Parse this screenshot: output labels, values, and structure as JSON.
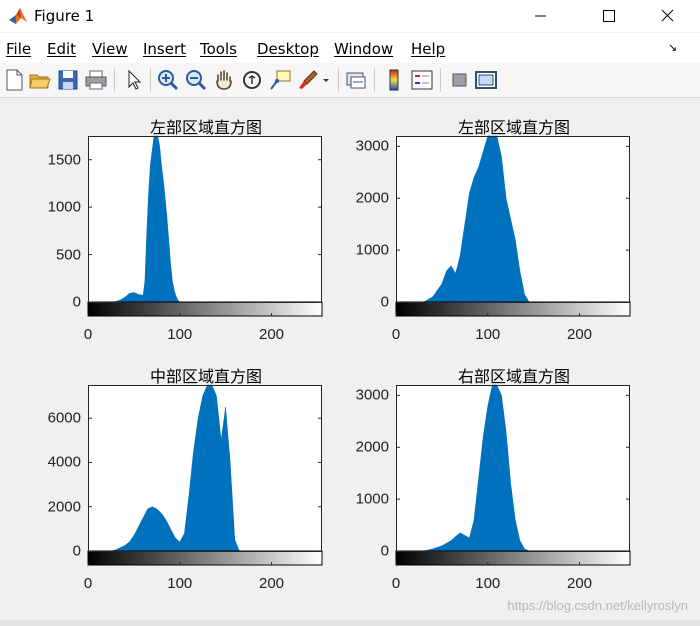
{
  "window": {
    "title": "Figure 1",
    "controls": [
      "minimize",
      "maximize",
      "close"
    ]
  },
  "menu": {
    "items": [
      "File",
      "Edit",
      "View",
      "Insert",
      "Tools",
      "Desktop",
      "Window",
      "Help"
    ]
  },
  "toolbar": {
    "icons": [
      "new-figure-icon",
      "open-file-icon",
      "save-icon",
      "print-icon",
      "select-arrow-icon",
      "zoom-in-icon",
      "zoom-out-icon",
      "pan-hand-icon",
      "rotate-3d-icon",
      "data-cursor-icon",
      "brush-icon",
      "brush-dropdown-icon",
      "link-plot-icon",
      "insert-colorbar-icon",
      "insert-legend-icon",
      "hide-plot-tools-icon",
      "show-plot-tools-icon"
    ]
  },
  "colors": {
    "bar": "#0072bd",
    "window_bg": "#f0f0f0",
    "axes_bg": "#ffffff"
  },
  "chart_data": [
    {
      "type": "bar",
      "title": "左部区域直方图",
      "xlim": [
        0,
        255
      ],
      "ylim": [
        0,
        1750
      ],
      "yticks": [
        0,
        500,
        1000,
        1500
      ],
      "xticks": [
        0,
        100,
        200
      ],
      "colorbar": "gray",
      "x": [
        25,
        30,
        35,
        40,
        45,
        50,
        55,
        60,
        62,
        64,
        66,
        68,
        70,
        72,
        74,
        76,
        78,
        80,
        82,
        84,
        86,
        88,
        90,
        92,
        94,
        96,
        98,
        100
      ],
      "values": [
        0,
        5,
        20,
        50,
        90,
        100,
        80,
        70,
        220,
        720,
        1150,
        1450,
        1600,
        1750,
        1750,
        1750,
        1650,
        1450,
        1300,
        1100,
        900,
        650,
        400,
        220,
        120,
        60,
        20,
        0
      ]
    },
    {
      "type": "bar",
      "title": "左部区域直方图",
      "xlim": [
        0,
        255
      ],
      "ylim": [
        0,
        3200
      ],
      "yticks": [
        0,
        1000,
        2000,
        3000
      ],
      "xticks": [
        0,
        100,
        200
      ],
      "colorbar": "gray",
      "x": [
        30,
        40,
        50,
        55,
        60,
        65,
        70,
        75,
        80,
        85,
        90,
        95,
        100,
        105,
        110,
        115,
        120,
        125,
        130,
        135,
        140,
        145
      ],
      "values": [
        0,
        100,
        350,
        600,
        700,
        550,
        900,
        1500,
        2100,
        2400,
        2600,
        2900,
        3200,
        3200,
        3200,
        2800,
        2000,
        1600,
        1200,
        600,
        150,
        0
      ]
    },
    {
      "type": "bar",
      "title": "中部区域直方图",
      "xlim": [
        0,
        255
      ],
      "ylim": [
        0,
        7500
      ],
      "yticks": [
        0,
        2000,
        4000,
        6000
      ],
      "xticks": [
        0,
        100,
        200
      ],
      "colorbar": "gray",
      "x": [
        25,
        30,
        35,
        40,
        45,
        50,
        55,
        60,
        65,
        70,
        75,
        80,
        85,
        90,
        95,
        100,
        105,
        110,
        115,
        120,
        125,
        130,
        135,
        140,
        145,
        150,
        155,
        160,
        165
      ],
      "values": [
        0,
        50,
        150,
        250,
        400,
        700,
        1100,
        1500,
        1900,
        2000,
        1900,
        1700,
        1400,
        1000,
        600,
        400,
        800,
        2500,
        4500,
        6000,
        7000,
        7500,
        7500,
        7000,
        5000,
        6500,
        4000,
        500,
        0
      ]
    },
    {
      "type": "bar",
      "title": "右部区域直方图",
      "xlim": [
        0,
        255
      ],
      "ylim": [
        0,
        3200
      ],
      "yticks": [
        0,
        1000,
        2000,
        3000
      ],
      "xticks": [
        0,
        100,
        200
      ],
      "colorbar": "gray",
      "x": [
        30,
        40,
        50,
        55,
        60,
        65,
        70,
        75,
        80,
        85,
        90,
        95,
        100,
        105,
        110,
        115,
        120,
        125,
        130,
        135,
        140,
        145
      ],
      "values": [
        0,
        40,
        100,
        150,
        200,
        280,
        350,
        300,
        250,
        600,
        1400,
        2200,
        2800,
        3200,
        3200,
        3000,
        2300,
        1300,
        600,
        200,
        40,
        0
      ]
    }
  ],
  "watermark": "https://blog.csdn.net/kellyroslyn"
}
